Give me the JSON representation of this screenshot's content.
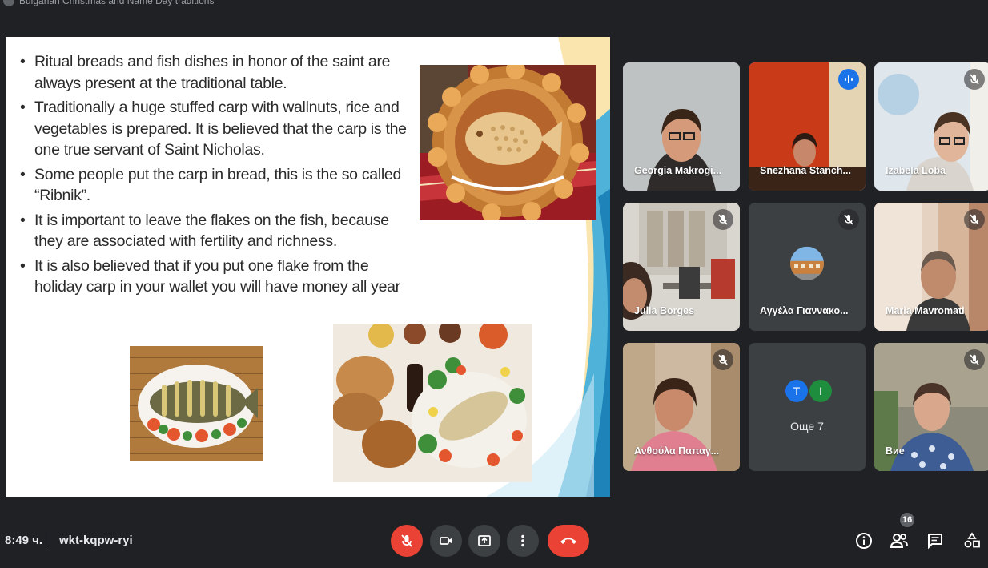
{
  "meeting": {
    "title": "Bulgarian Christmas and Name Day traditions",
    "time": "8:49 ч.",
    "code": "wkt-kqpw-ryi",
    "participant_count": "16"
  },
  "slide": {
    "bullets": [
      "Ritual breads and fish dishes in honor of the saint are always present at the traditional table.",
      "Traditionally a huge stuffed carp with wallnuts, rice and vegetables is prepared. It is believed that the carp is the one true servant of Saint Nicholas.",
      "Some people put the carp in bread, this is the so called “Ribnik”.",
      "It is important to leave the flakes on the fish, because they are associated with fertility and richness.",
      "It is also believed that if you put one flake from the holiday carp in your wallet you will have money all year"
    ]
  },
  "participants": [
    {
      "name": "Georgia Makrogi...",
      "muted": false,
      "speaking": false
    },
    {
      "name": "Snezhana Stanch...",
      "muted": false,
      "speaking": true
    },
    {
      "name": "Izabela Loba",
      "muted": true,
      "speaking": false
    },
    {
      "name": "Julia Borges",
      "muted": true,
      "speaking": false
    },
    {
      "name": "Αγγέλα Γιαννακο...",
      "muted": true,
      "speaking": false
    },
    {
      "name": "Maria Mavromati",
      "muted": true,
      "speaking": false
    },
    {
      "name": "Ανθούλα Παπαγ...",
      "muted": true,
      "speaking": false
    },
    {
      "name": "Вие",
      "muted": true,
      "speaking": false
    }
  ],
  "more_tile": {
    "label": "Още 7",
    "avatars": [
      {
        "letter": "T",
        "color": "#1a73e8"
      },
      {
        "letter": "I",
        "color": "#1e8e3e"
      }
    ]
  },
  "colors": {
    "background": "#202124",
    "tile": "#3c4043",
    "danger": "#ea4335",
    "accent": "#8ab4f8"
  },
  "icons": {
    "controls": [
      "mic-off-icon",
      "camera-icon",
      "present-screen-icon",
      "more-options-icon",
      "hang-up-icon"
    ],
    "side": [
      "info-icon",
      "people-icon",
      "chat-icon",
      "activities-icon"
    ]
  }
}
